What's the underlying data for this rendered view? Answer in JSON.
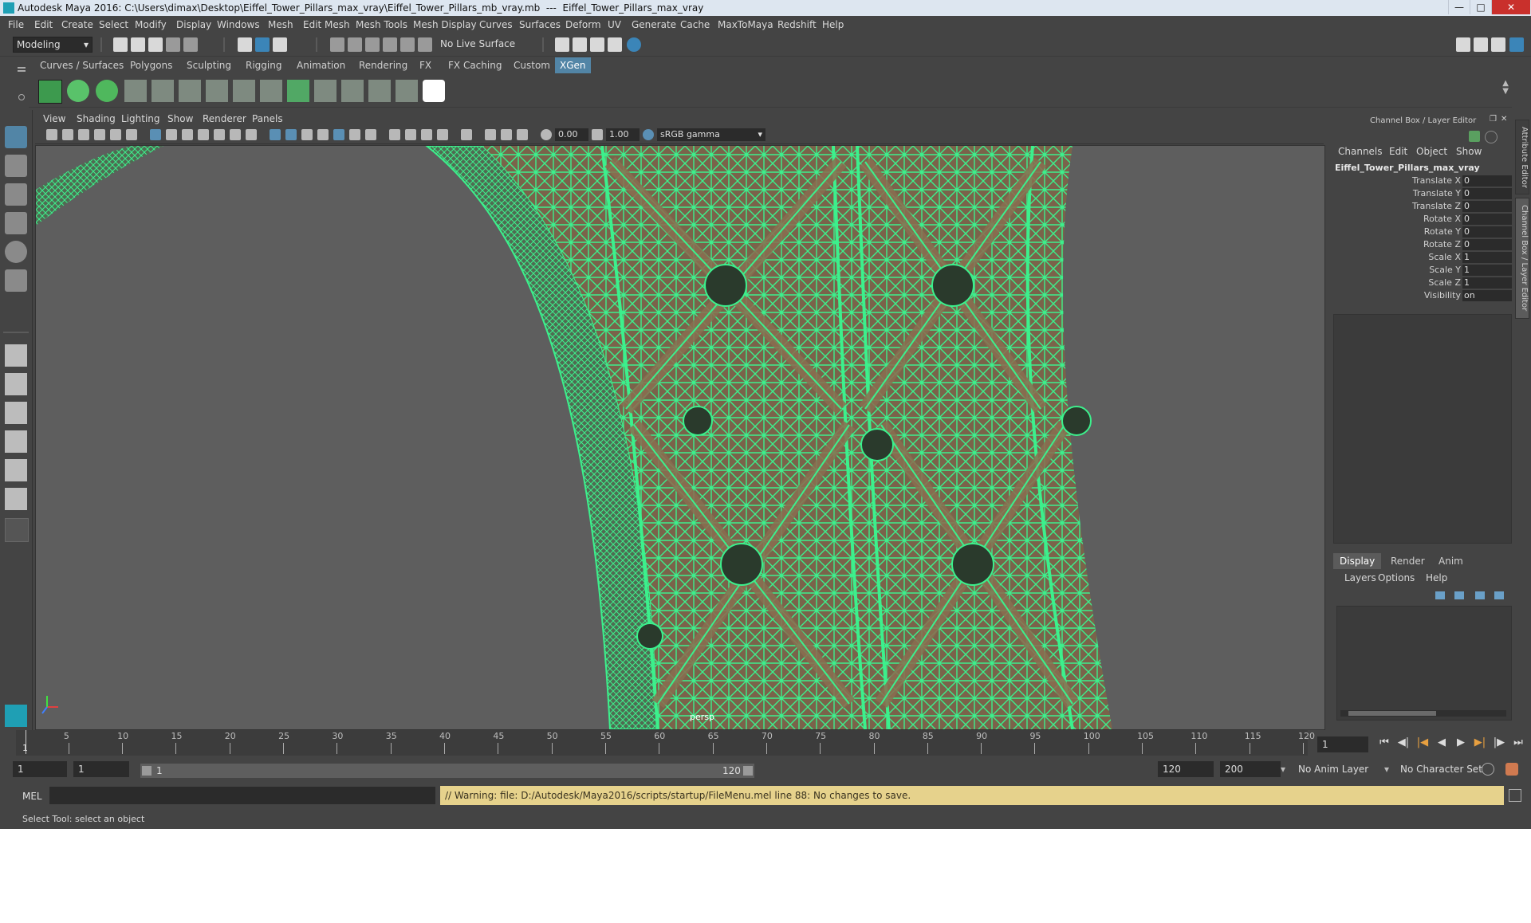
{
  "window": {
    "title": "Autodesk Maya 2016: C:\\Users\\dimax\\Desktop\\Eiffel_Tower_Pillars_max_vray\\Eiffel_Tower_Pillars_mb_vray.mb  ---  Eiffel_Tower_Pillars_max_vray",
    "minimize": "—",
    "maximize": "□",
    "close": "✕"
  },
  "menubar": [
    "File",
    "Edit",
    "Create",
    "Select",
    "Modify",
    "Display",
    "Windows",
    "Mesh",
    "Edit Mesh",
    "Mesh Tools",
    "Mesh Display",
    "Curves",
    "Surfaces",
    "Deform",
    "UV",
    "Generate",
    "Cache",
    "MaxToMaya",
    "Redshift",
    "Help"
  ],
  "statusline": {
    "mode": "Modeling",
    "live_surface": "No Live Surface"
  },
  "shelf": {
    "tabs": [
      "Curves / Surfaces",
      "Polygons",
      "Sculpting",
      "Rigging",
      "Animation",
      "Rendering",
      "FX",
      "FX Caching",
      "Custom",
      "XGen"
    ],
    "active_tab": "XGen"
  },
  "viewport": {
    "menu": [
      "View",
      "Shading",
      "Lighting",
      "Show",
      "Renderer",
      "Panels"
    ],
    "exposure": "0.00",
    "gamma": "1.00",
    "color_space": "sRGB gamma",
    "camera_label": "persp"
  },
  "channel_box": {
    "header": "Channel Box / Layer Editor",
    "menu": [
      "Channels",
      "Edit",
      "Object",
      "Show"
    ],
    "object_name": "Eiffel_Tower_Pillars_max_vray",
    "channels": [
      {
        "label": "Translate X",
        "value": "0"
      },
      {
        "label": "Translate Y",
        "value": "0"
      },
      {
        "label": "Translate Z",
        "value": "0"
      },
      {
        "label": "Rotate X",
        "value": "0"
      },
      {
        "label": "Rotate Y",
        "value": "0"
      },
      {
        "label": "Rotate Z",
        "value": "0"
      },
      {
        "label": "Scale X",
        "value": "1"
      },
      {
        "label": "Scale Y",
        "value": "1"
      },
      {
        "label": "Scale Z",
        "value": "1"
      },
      {
        "label": "Visibility",
        "value": "on"
      }
    ],
    "side_tabs": [
      "Attribute Editor",
      "Channel Box / Layer Editor"
    ]
  },
  "layer_editor": {
    "tabs": [
      "Display",
      "Render",
      "Anim"
    ],
    "active_tab": "Display",
    "menu": [
      "Layers",
      "Options",
      "Help"
    ]
  },
  "timeline": {
    "ticks": [
      "5",
      "10",
      "15",
      "20",
      "25",
      "30",
      "35",
      "40",
      "45",
      "50",
      "55",
      "60",
      "65",
      "70",
      "75",
      "80",
      "85",
      "90",
      "95",
      "100",
      "105",
      "110",
      "115",
      "120"
    ],
    "start_marker": "1",
    "current_frame": "1"
  },
  "range": {
    "start": "1",
    "playback_start": "1",
    "slider_start": "1",
    "slider_end": "120",
    "playback_end": "120",
    "end": "200",
    "anim_layer": "No Anim Layer",
    "character_set": "No Character Set"
  },
  "command": {
    "language": "MEL",
    "warning": "// Warning: file: D:/Autodesk/Maya2016/scripts/startup/FileMenu.mel line 88: No changes to save."
  },
  "help_line": "Select Tool: select an object",
  "colors": {
    "wireframe": "#3cf08c",
    "steel": "#7a634a",
    "viewport_bg": "#5e5e5e",
    "active_tab": "#5285a6",
    "warning_bg": "#e6d28c"
  }
}
